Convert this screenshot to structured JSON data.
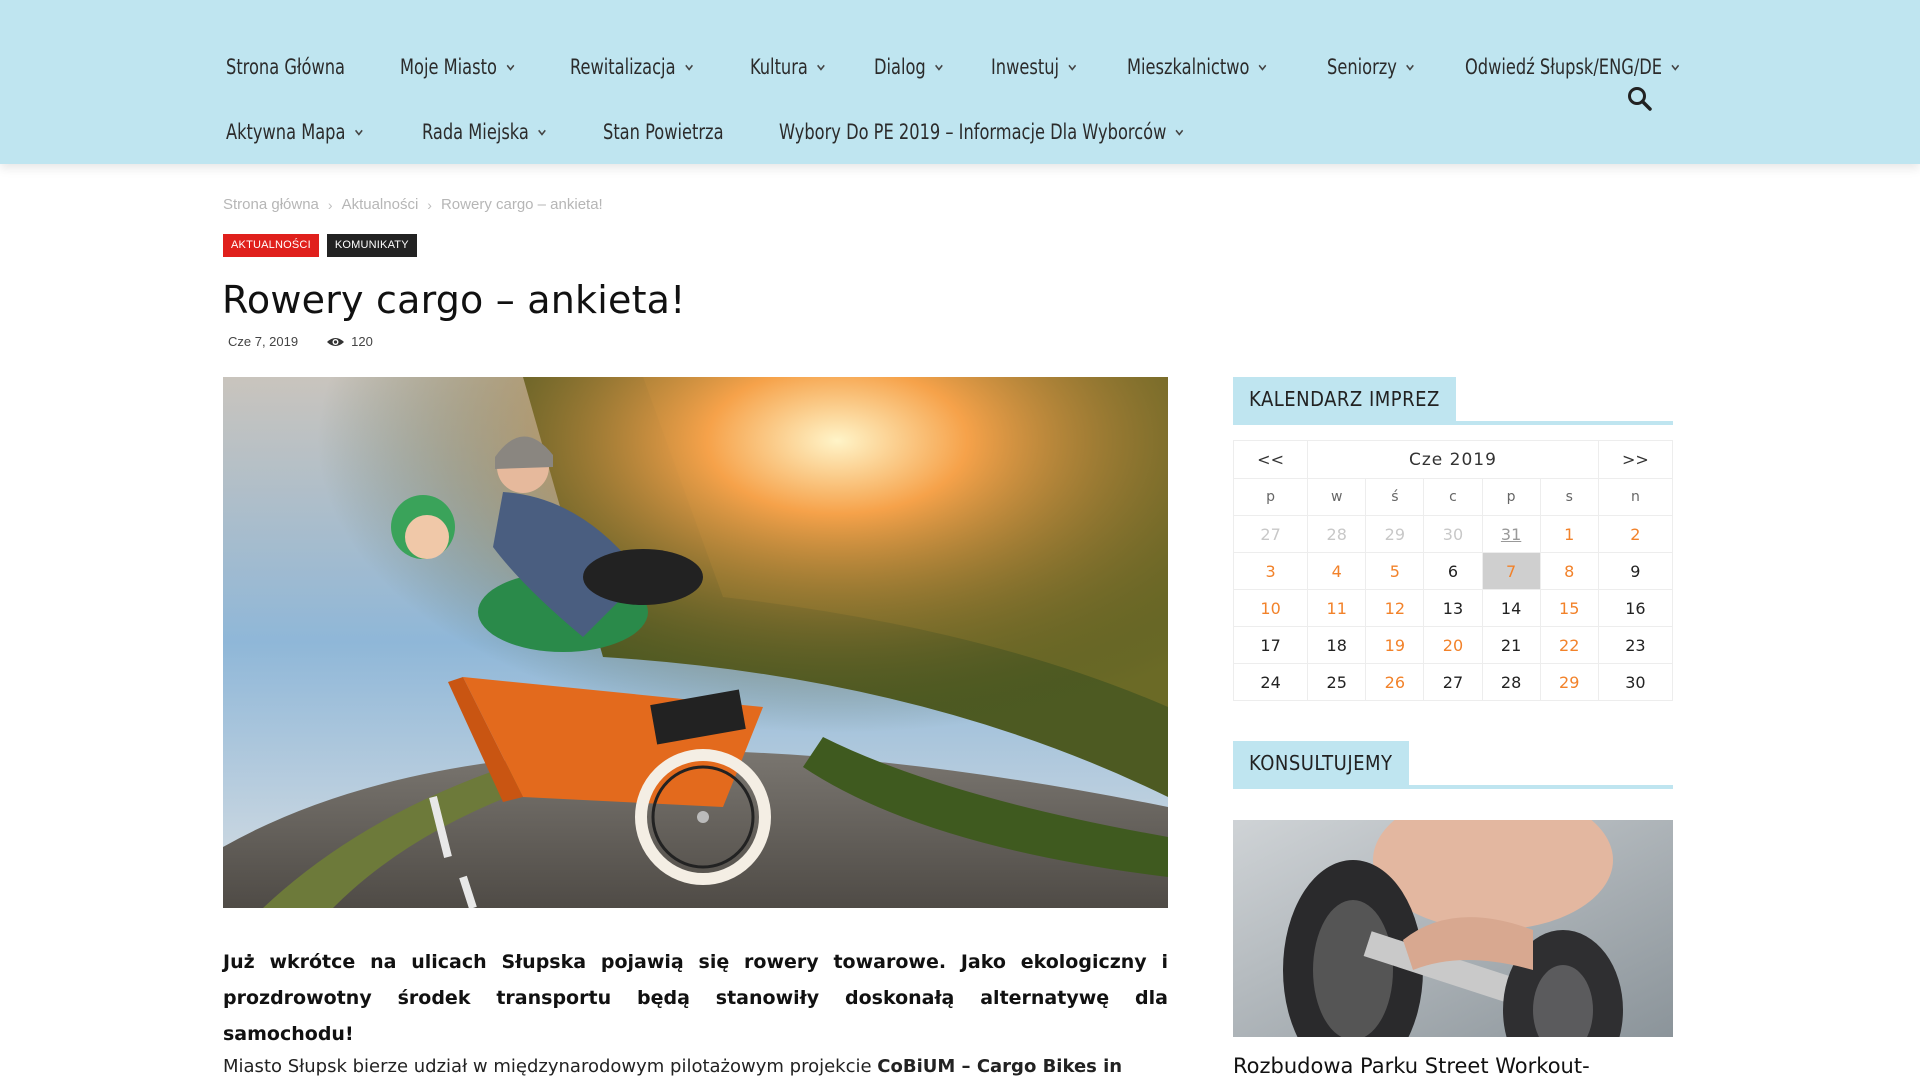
{
  "nav": {
    "row1": [
      {
        "label": "Strona Główna",
        "has_dropdown": false
      },
      {
        "label": "Moje Miasto",
        "has_dropdown": true
      },
      {
        "label": "Rewitalizacja",
        "has_dropdown": true
      },
      {
        "label": "Kultura",
        "has_dropdown": true
      },
      {
        "label": "Dialog",
        "has_dropdown": true
      },
      {
        "label": "Inwestuj",
        "has_dropdown": true
      },
      {
        "label": "Mieszkalnictwo",
        "has_dropdown": true
      },
      {
        "label": "Seniorzy",
        "has_dropdown": true
      },
      {
        "label": "Odwiedź Słupsk/ENG/DE",
        "has_dropdown": true
      }
    ],
    "row2": [
      {
        "label": "Aktywna Mapa",
        "has_dropdown": true
      },
      {
        "label": "Rada Miejska",
        "has_dropdown": true
      },
      {
        "label": "Stan Powietrza",
        "has_dropdown": false
      },
      {
        "label": "Wybory Do PE 2019 – Informacje Dla Wyborców",
        "has_dropdown": true
      }
    ],
    "search_icon": "search-icon"
  },
  "breadcrumb": [
    "Strona główna",
    "Aktualności",
    "Rowery cargo – ankieta!"
  ],
  "tags": [
    {
      "label": "AKTUALNOŚCI",
      "color": "#e0201c"
    },
    {
      "label": "KOMUNIKATY",
      "color": "#222222"
    }
  ],
  "article": {
    "title": "Rowery cargo – ankieta!",
    "date": "Cze 7, 2019",
    "views": "120",
    "lead": "Już wkrótce na ulicach Słupska pojawią się rowery towarowe. Jako ekologiczny i prozdrowotny środek transportu będą stanowiły doskonałą alternatywę dla samochodu!",
    "body_start": "Miasto Słupsk bierze udział w międzynarodowym pilotażowym projekcie ",
    "body_bold": "CoBiUM – Cargo Bikes in"
  },
  "calendar": {
    "heading": "KALENDARZ IMPREZ",
    "prev": "<<",
    "month": "Cze 2019",
    "next": ">>",
    "weekdays": [
      "p",
      "w",
      "ś",
      "c",
      "p",
      "s",
      "n"
    ],
    "weeks": [
      [
        {
          "d": "27",
          "t": "pad"
        },
        {
          "d": "28",
          "t": "pad"
        },
        {
          "d": "29",
          "t": "pad"
        },
        {
          "d": "30",
          "t": "pad"
        },
        {
          "d": "31",
          "t": "pad-u"
        },
        {
          "d": "1",
          "t": "ev"
        },
        {
          "d": "2",
          "t": "ev"
        }
      ],
      [
        {
          "d": "3",
          "t": "ev"
        },
        {
          "d": "4",
          "t": "ev"
        },
        {
          "d": "5",
          "t": "ev"
        },
        {
          "d": "6",
          "t": ""
        },
        {
          "d": "7",
          "t": "today"
        },
        {
          "d": "8",
          "t": "ev"
        },
        {
          "d": "9",
          "t": ""
        }
      ],
      [
        {
          "d": "10",
          "t": "ev"
        },
        {
          "d": "11",
          "t": "ev"
        },
        {
          "d": "12",
          "t": "ev"
        },
        {
          "d": "13",
          "t": ""
        },
        {
          "d": "14",
          "t": ""
        },
        {
          "d": "15",
          "t": "ev"
        },
        {
          "d": "16",
          "t": ""
        }
      ],
      [
        {
          "d": "17",
          "t": ""
        },
        {
          "d": "18",
          "t": ""
        },
        {
          "d": "19",
          "t": "ev"
        },
        {
          "d": "20",
          "t": "ev"
        },
        {
          "d": "21",
          "t": ""
        },
        {
          "d": "22",
          "t": "ev"
        },
        {
          "d": "23",
          "t": ""
        }
      ],
      [
        {
          "d": "24",
          "t": ""
        },
        {
          "d": "25",
          "t": ""
        },
        {
          "d": "26",
          "t": "ev"
        },
        {
          "d": "27",
          "t": ""
        },
        {
          "d": "28",
          "t": ""
        },
        {
          "d": "29",
          "t": "ev"
        },
        {
          "d": "30",
          "t": ""
        }
      ]
    ]
  },
  "konsult": {
    "heading": "KONSULTUJEMY",
    "post_title": "Rozbudowa Parku Street Workout-"
  },
  "colors": {
    "header_bg": "#bfe5f0",
    "accent_event": "#f2822a",
    "tag_red": "#e0201c"
  }
}
